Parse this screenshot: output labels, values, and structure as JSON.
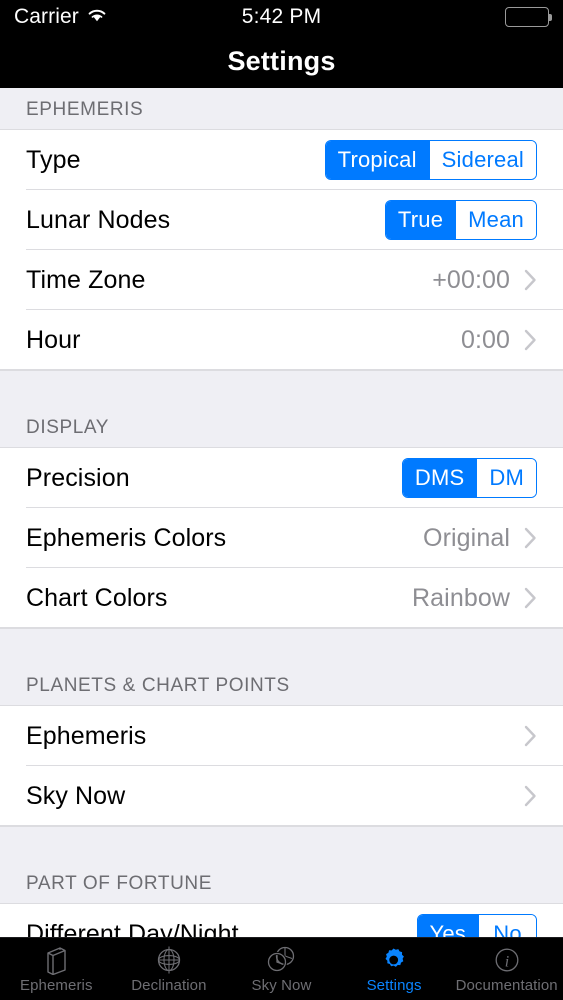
{
  "status_bar": {
    "carrier": "Carrier",
    "time": "5:42 PM",
    "wifi_icon": "wifi-icon",
    "battery_icon": "battery-full-icon"
  },
  "nav": {
    "title": "Settings"
  },
  "sections": [
    {
      "header": "EPHEMERIS",
      "rows": [
        {
          "label": "Type",
          "control": "segmented",
          "options": [
            "Tropical",
            "Sidereal"
          ],
          "selected": "Tropical"
        },
        {
          "label": "Lunar Nodes",
          "control": "segmented",
          "options": [
            "True",
            "Mean"
          ],
          "selected": "True"
        },
        {
          "label": "Time Zone",
          "control": "disclosure",
          "value": "+00:00"
        },
        {
          "label": "Hour",
          "control": "disclosure",
          "value": "0:00"
        }
      ]
    },
    {
      "header": "DISPLAY",
      "rows": [
        {
          "label": "Precision",
          "control": "segmented",
          "options": [
            "DMS",
            "DM"
          ],
          "selected": "DMS"
        },
        {
          "label": "Ephemeris Colors",
          "control": "disclosure",
          "value": "Original"
        },
        {
          "label": "Chart Colors",
          "control": "disclosure",
          "value": "Rainbow"
        }
      ]
    },
    {
      "header": "PLANETS & CHART POINTS",
      "rows": [
        {
          "label": "Ephemeris",
          "control": "disclosure",
          "value": ""
        },
        {
          "label": "Sky Now",
          "control": "disclosure",
          "value": ""
        }
      ]
    },
    {
      "header": "PART OF FORTUNE",
      "rows": [
        {
          "label": "Different Day/Night",
          "control": "segmented",
          "options": [
            "Yes",
            "No"
          ],
          "selected": "Yes"
        }
      ]
    }
  ],
  "tab_bar": {
    "tabs": [
      {
        "label": "Ephemeris",
        "icon": "book-icon",
        "active": false
      },
      {
        "label": "Declination",
        "icon": "globe-icon",
        "active": false
      },
      {
        "label": "Sky Now",
        "icon": "clock-circles-icon",
        "active": false
      },
      {
        "label": "Settings",
        "icon": "gear-icon",
        "active": true
      },
      {
        "label": "Documentation",
        "icon": "info-circle-icon",
        "active": false
      }
    ]
  },
  "colors": {
    "accent": "#007aff",
    "tab_active": "#0a84ff",
    "tab_inactive": "#6e6e73",
    "section_bg": "#efeff4",
    "value_text": "#8e8e93",
    "chevron": "#c7c7cc"
  }
}
